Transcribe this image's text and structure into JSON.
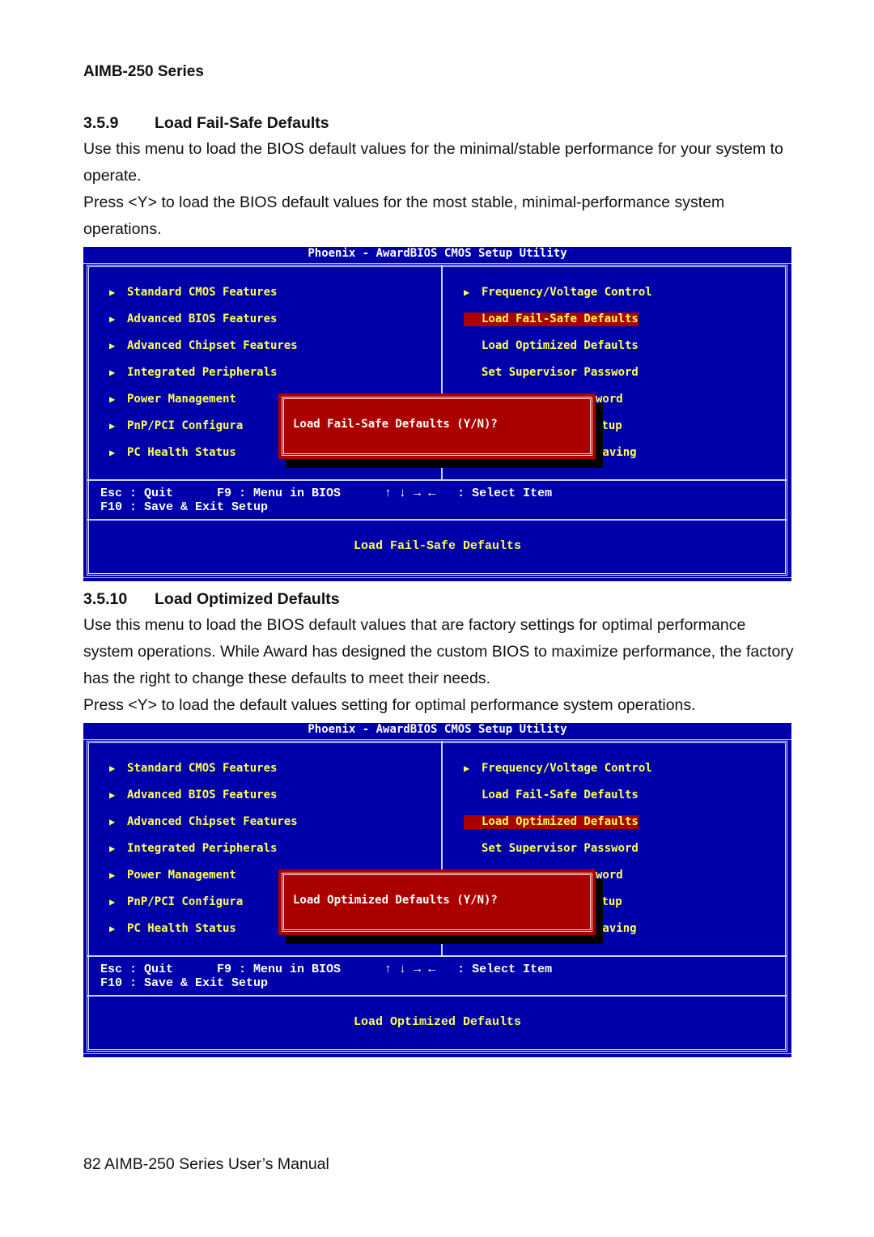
{
  "page": {
    "running_head": "AIMB-250 Series",
    "footer": "82 AIMB-250 Series User’s Manual"
  },
  "sections": [
    {
      "number": "3.5.9",
      "title": "Load Fail-Safe Defaults",
      "paragraphs": [
        "Use this menu to load the BIOS default values for the minimal/stable performance for your system to operate.",
        "Press <Y> to load the BIOS default values for the most stable, minimal-performance system operations."
      ]
    },
    {
      "number": "3.5.10",
      "title": "Load Optimized Defaults",
      "paragraphs": [
        "Use this menu to load the BIOS default values that are factory settings for optimal performance system operations. While Award has designed the custom BIOS to maximize performance, the factory has the right to change these defaults to meet their needs.",
        "Press <Y> to load the default values setting for optimal performance system operations."
      ]
    }
  ],
  "bios_screens": [
    {
      "title": "Phoenix - AwardBIOS CMOS Setup Utility",
      "left_menu": [
        {
          "label": "Standard CMOS Features",
          "icon": "triangle-right-icon"
        },
        {
          "label": "Advanced BIOS Features",
          "icon": "triangle-right-icon"
        },
        {
          "label": "Advanced Chipset Features",
          "icon": "triangle-right-icon"
        },
        {
          "label": "Integrated Peripherals",
          "icon": "triangle-right-icon"
        },
        {
          "label": "Power Management",
          "icon": "triangle-right-icon"
        },
        {
          "label": "PnP/PCI Configura",
          "icon": "triangle-right-icon"
        },
        {
          "label": "PC Health Status",
          "icon": "triangle-right-icon"
        }
      ],
      "right_menu": [
        {
          "label": "Frequency/Voltage Control",
          "icon": "triangle-right-icon",
          "selected": false
        },
        {
          "label": "Load Fail-Safe Defaults",
          "selected": true
        },
        {
          "label": "Load Optimized Defaults",
          "selected": false
        },
        {
          "label": "Set Supervisor Password",
          "selected": false
        }
      ],
      "right_partial": [
        "word",
        "etup",
        "Saving"
      ],
      "dialog": "Load Fail-Safe Defaults (Y/N)?",
      "keys_line1": "Esc : Quit      F9 : Menu in BIOS      ↑ ↓ → ←   : Select Item",
      "keys_line2": "F10 : Save & Exit Setup",
      "status": "Load Fail-Safe Defaults"
    },
    {
      "title": "Phoenix - AwardBIOS CMOS Setup Utility",
      "left_menu": [
        {
          "label": "Standard CMOS Features",
          "icon": "triangle-right-icon"
        },
        {
          "label": "Advanced BIOS Features",
          "icon": "triangle-right-icon"
        },
        {
          "label": "Advanced Chipset Features",
          "icon": "triangle-right-icon"
        },
        {
          "label": "Integrated Peripherals",
          "icon": "triangle-right-icon"
        },
        {
          "label": "Power Management",
          "icon": "triangle-right-icon"
        },
        {
          "label": "PnP/PCI Configura",
          "icon": "triangle-right-icon"
        },
        {
          "label": "PC Health Status",
          "icon": "triangle-right-icon"
        }
      ],
      "right_menu": [
        {
          "label": "Frequency/Voltage Control",
          "icon": "triangle-right-icon",
          "selected": false
        },
        {
          "label": "Load Fail-Safe Defaults",
          "selected": false
        },
        {
          "label": "Load Optimized Defaults",
          "selected": true
        },
        {
          "label": "Set Supervisor Password",
          "selected": false
        }
      ],
      "right_partial": [
        "word",
        "etup",
        "Saving"
      ],
      "dialog": "Load Optimized Defaults (Y/N)?",
      "keys_line1": "Esc : Quit      F9 : Menu in BIOS      ↑ ↓ → ←   : Select Item",
      "keys_line2": "F10 : Save & Exit Setup",
      "status": "Load Optimized Defaults"
    }
  ],
  "glyphs": {
    "arrow": "▶"
  },
  "colors": {
    "bios_bg": "#0000aa",
    "menu_text": "#ffff55",
    "highlight": "#aa0000",
    "dialog_bg": "#aa0000"
  }
}
